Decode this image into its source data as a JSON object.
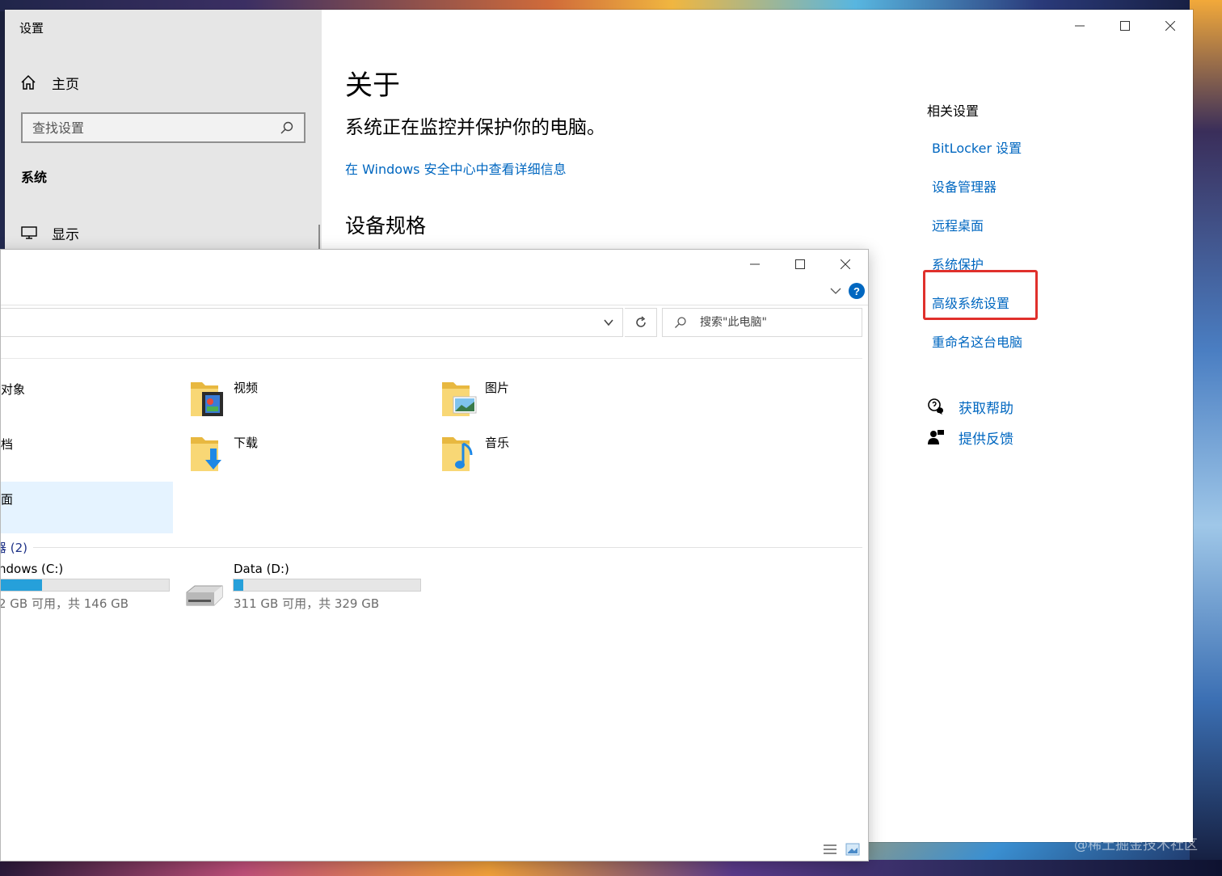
{
  "settings": {
    "title": "设置",
    "sidebar": {
      "home_label": "主页",
      "search_placeholder": "查找设置",
      "section_label": "系统",
      "items": [
        {
          "label": "显示",
          "icon": "monitor-icon"
        }
      ]
    },
    "main": {
      "title": "关于",
      "status": "系统正在监控并保护你的电脑。",
      "security_link": "在 Windows 安全中心中查看详细信息",
      "specs_title": "设备规格"
    },
    "related": {
      "heading": "相关设置",
      "links": [
        "BitLocker 设置",
        "设备管理器",
        "远程桌面",
        "系统保护",
        "高级系统设置",
        "重命名这台电脑"
      ],
      "highlighted": "高级系统设置"
    },
    "help": {
      "get_help": "获取帮助",
      "feedback": "提供反馈"
    }
  },
  "explorer": {
    "search_placeholder": "搜索\"此电脑\"",
    "help_glyph": "?",
    "folders": [
      {
        "label": "对象",
        "partial": true
      },
      {
        "label": "视频",
        "icon": "videos-folder-icon"
      },
      {
        "label": "图片",
        "icon": "pictures-folder-icon"
      },
      {
        "label": "档",
        "partial": true
      },
      {
        "label": "下载",
        "icon": "downloads-folder-icon"
      },
      {
        "label": "音乐",
        "icon": "music-folder-icon"
      },
      {
        "label": "面",
        "partial": true
      }
    ],
    "devices_header": "器 (2)",
    "drives": [
      {
        "name": "ndows (C:)",
        "free_text": "2 GB 可用，共 146 GB",
        "used_fraction": 0.25
      },
      {
        "name": "Data (D:)",
        "free_text": "311 GB 可用，共 329 GB",
        "used_fraction": 0.05
      }
    ]
  },
  "watermark": "@稀土掘金技术社区",
  "colors": {
    "link": "#0067c0",
    "highlight_border": "#e0302c",
    "drive_fill": "#26a0da",
    "selection": "#e5f3ff"
  }
}
